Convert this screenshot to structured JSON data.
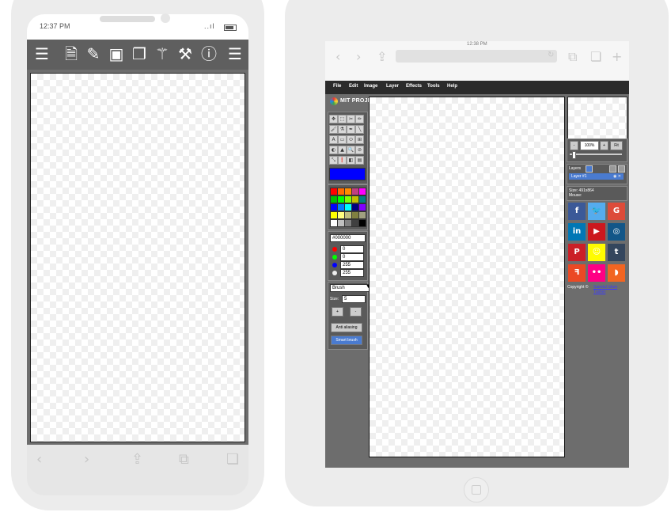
{
  "phone": {
    "status": {
      "time": "12:37 PM",
      "signal": "..ıl"
    },
    "toolbar": [
      {
        "name": "menu-icon",
        "glyph": "☰"
      },
      {
        "name": "file-icon",
        "glyph": "🗎"
      },
      {
        "name": "edit-icon",
        "glyph": "✎"
      },
      {
        "name": "image-icon",
        "glyph": "▣"
      },
      {
        "name": "layers-icon",
        "glyph": "❐"
      },
      {
        "name": "magic-wand-icon",
        "glyph": "⚚"
      },
      {
        "name": "hammer-icon",
        "glyph": "⚒"
      },
      {
        "name": "info-icon",
        "glyph": "ⓘ"
      },
      {
        "name": "hamburger-icon",
        "glyph": "☰"
      }
    ],
    "nav": [
      {
        "name": "back-icon",
        "glyph": "‹"
      },
      {
        "name": "forward-icon",
        "glyph": "›"
      },
      {
        "name": "share-icon",
        "glyph": "⇪"
      },
      {
        "name": "bookmarks-icon",
        "glyph": "⧉"
      },
      {
        "name": "tabs-icon",
        "glyph": "❏"
      }
    ]
  },
  "tablet": {
    "status": {
      "time": "12:38 PM"
    },
    "nav": [
      {
        "name": "back-icon",
        "glyph": "‹"
      },
      {
        "name": "forward-icon",
        "glyph": "›"
      },
      {
        "name": "share-icon",
        "glyph": "⇪"
      },
      {
        "name": "reload-icon",
        "glyph": "↻"
      },
      {
        "name": "bookmarks-icon",
        "glyph": "⧉"
      },
      {
        "name": "tabs-icon",
        "glyph": "❏"
      },
      {
        "name": "new-tab-icon",
        "glyph": "+"
      }
    ]
  },
  "app": {
    "menu": [
      "File",
      "Edit",
      "Image",
      "Layer",
      "Effects",
      "Tools",
      "Help"
    ],
    "logo_text": "MIT PROJECT",
    "active_color": "#0000ff",
    "palette": [
      "#ff0000",
      "#ff6a00",
      "#ff8c00",
      "#c04080",
      "#ff00ff",
      "#00c000",
      "#00ff00",
      "#80ff00",
      "#c0c000",
      "#008080",
      "#0000ff",
      "#0080ff",
      "#00ffff",
      "#000080",
      "#8000ff",
      "#ffff00",
      "#ffff80",
      "#c0c080",
      "#808040",
      "#a0a080",
      "#ffffff",
      "#c0c0c0",
      "#808080",
      "#404040",
      "#000000"
    ],
    "hex_value": "#000000",
    "rgba": [
      "0",
      "0",
      "255",
      "255"
    ],
    "tool_select": "Brush",
    "size_label": "Size:",
    "size_value": "5",
    "plus": "+",
    "minus": "-",
    "anti_alias": "Anti aliasing",
    "smart_brush": "Smart brush",
    "zoom": {
      "minus": "-",
      "value": "100%",
      "plus": "+",
      "fit": "Fit"
    },
    "layers_label": "Layers",
    "layer_name": "Layer #1",
    "size_info": "Size:   491x864",
    "mouse_info": "Mouse:",
    "copyright": "Copyright ©",
    "author": "Saiedul Islam Tusher"
  },
  "social": [
    {
      "name": "facebook-icon",
      "glyph": "f",
      "color": "#3b5998"
    },
    {
      "name": "twitter-icon",
      "glyph": "🐦",
      "color": "#55acee"
    },
    {
      "name": "google-icon",
      "glyph": "G",
      "color": "#dd4b39"
    },
    {
      "name": "linkedin-icon",
      "glyph": "in",
      "color": "#0077b5"
    },
    {
      "name": "youtube-icon",
      "glyph": "▶",
      "color": "#cc181e"
    },
    {
      "name": "instagram-icon",
      "glyph": "◎",
      "color": "#125688"
    },
    {
      "name": "pinterest-icon",
      "glyph": "P",
      "color": "#cb2027"
    },
    {
      "name": "snapchat-icon",
      "glyph": "☺",
      "color": "#fffc00"
    },
    {
      "name": "tumblr-icon",
      "glyph": "t",
      "color": "#34465d"
    },
    {
      "name": "stumbleupon-icon",
      "glyph": "ꟻ",
      "color": "#eb4924"
    },
    {
      "name": "flickr-icon",
      "glyph": "••",
      "color": "#ff0084"
    },
    {
      "name": "rss-icon",
      "glyph": "◗",
      "color": "#f26522"
    }
  ]
}
